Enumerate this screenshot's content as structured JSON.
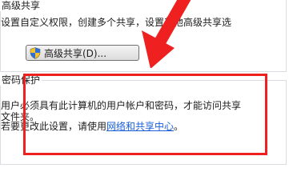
{
  "advanced_sharing": {
    "title": "高级共享",
    "description": "设置自定义权限，创建多个共享，设置其他高级共享选",
    "button_label": "高级共享(D)..."
  },
  "password_protection": {
    "title": "密码保护",
    "description": "用户必须具有此计算机的用户帐户和密码，才能访问共享文件夹。",
    "change_prefix": "若要更改此设置，请使用",
    "link_text": "网络和共享中心",
    "change_suffix": "。"
  },
  "annotation_color": "#ef2020",
  "icons": {
    "button": "uac-shield-icon"
  }
}
